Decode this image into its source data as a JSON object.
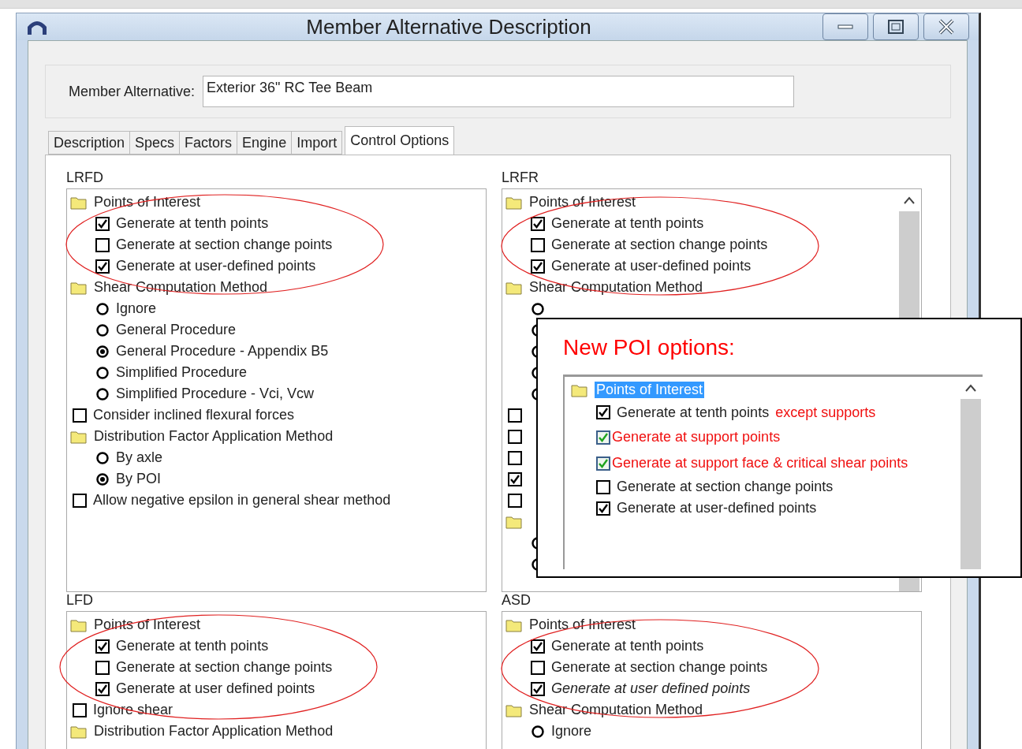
{
  "window": {
    "title": "Member Alternative Description"
  },
  "member_alternative": {
    "label": "Member Alternative:",
    "value": "Exterior 36\" RC Tee Beam"
  },
  "tabs": [
    {
      "label": "Description",
      "selected": false
    },
    {
      "label": "Specs",
      "selected": false
    },
    {
      "label": "Factors",
      "selected": false
    },
    {
      "label": "Engine",
      "selected": false
    },
    {
      "label": "Import",
      "selected": false
    },
    {
      "label": "Control Options",
      "selected": true
    }
  ],
  "panels": [
    {
      "title": "LRFD",
      "scrollable": false,
      "rows": [
        {
          "kind": "folder",
          "label": "Points of Interest",
          "children": [
            {
              "kind": "checkbox",
              "label": "Generate at tenth points",
              "checked": true
            },
            {
              "kind": "checkbox",
              "label": "Generate at section change points",
              "checked": false
            },
            {
              "kind": "checkbox",
              "label": "Generate at user-defined points",
              "checked": true
            }
          ]
        },
        {
          "kind": "folder",
          "label": "Shear Computation Method",
          "children": [
            {
              "kind": "radio",
              "label": "Ignore",
              "selected": false
            },
            {
              "kind": "radio",
              "label": "General Procedure",
              "selected": false
            },
            {
              "kind": "radio",
              "label": "General Procedure - Appendix B5",
              "selected": true
            },
            {
              "kind": "radio",
              "label": "Simplified Procedure",
              "selected": false
            },
            {
              "kind": "radio",
              "label": "Simplified Procedure - Vci, Vcw",
              "selected": false
            }
          ]
        },
        {
          "kind": "checkbox",
          "label": "Consider inclined flexural forces",
          "checked": false
        },
        {
          "kind": "folder",
          "label": "Distribution Factor Application Method",
          "children": [
            {
              "kind": "radio",
              "label": "By axle",
              "selected": false
            },
            {
              "kind": "radio",
              "label": "By POI",
              "selected": true
            }
          ]
        },
        {
          "kind": "checkbox",
          "label": "Allow negative epsilon in general shear method",
          "checked": false
        }
      ]
    },
    {
      "title": "LRFR",
      "scrollable": true,
      "rows": [
        {
          "kind": "folder",
          "label": "Points of Interest",
          "children": [
            {
              "kind": "checkbox",
              "label": "Generate at tenth points",
              "checked": true
            },
            {
              "kind": "checkbox",
              "label": "Generate at section change points",
              "checked": false
            },
            {
              "kind": "checkbox",
              "label": "Generate at user-defined points",
              "checked": true
            }
          ]
        },
        {
          "kind": "folder",
          "label": "Shear Computation Method",
          "children": [
            {
              "kind": "radio",
              "selected": false
            },
            {
              "kind": "radio",
              "selected": false
            },
            {
              "kind": "radio",
              "selected": false
            },
            {
              "kind": "radio",
              "selected": false
            },
            {
              "kind": "radio",
              "selected": false
            }
          ]
        },
        {
          "kind": "checkbox",
          "checked": false
        },
        {
          "kind": "checkbox",
          "checked": false
        },
        {
          "kind": "checkbox",
          "checked": false
        },
        {
          "kind": "checkbox",
          "checked": true
        },
        {
          "kind": "checkbox",
          "checked": false
        },
        {
          "kind": "folder",
          "children": [
            {
              "kind": "radio",
              "selected": false
            },
            {
              "kind": "radio",
              "selected": false
            }
          ]
        }
      ]
    },
    {
      "title": "LFD",
      "scrollable": false,
      "rows": [
        {
          "kind": "folder",
          "label": "Points of Interest",
          "children": [
            {
              "kind": "checkbox",
              "label": "Generate at tenth points",
              "checked": true
            },
            {
              "kind": "checkbox",
              "label": "Generate at section change points",
              "checked": false
            },
            {
              "kind": "checkbox",
              "label": "Generate at user defined points",
              "checked": true
            }
          ]
        },
        {
          "kind": "checkbox",
          "label": "Ignore shear",
          "checked": false
        },
        {
          "kind": "folder",
          "label": "Distribution Factor Application Method"
        }
      ]
    },
    {
      "title": "ASD",
      "scrollable": false,
      "rows": [
        {
          "kind": "folder",
          "label": "Points of Interest",
          "children": [
            {
              "kind": "checkbox",
              "label": "Generate at tenth points",
              "checked": true
            },
            {
              "kind": "checkbox",
              "label": "Generate at section change points",
              "checked": false
            },
            {
              "kind": "checkbox",
              "label": "Generate at user defined points",
              "checked": true,
              "italic": true
            }
          ]
        },
        {
          "kind": "folder",
          "label": "Shear Computation Method",
          "children": [
            {
              "kind": "radio",
              "label": "Ignore",
              "selected": false
            }
          ]
        }
      ]
    }
  ],
  "callout": {
    "title": "New POI options:",
    "folder": {
      "label": "Points of Interest",
      "selected": true
    },
    "rows": [
      {
        "kind": "checkbox",
        "label": "Generate at tenth points",
        "note": "except supports",
        "checked": true
      },
      {
        "kind": "new_checkbox",
        "label": "Generate at support points",
        "checked": true
      },
      {
        "kind": "new_checkbox",
        "label": "Generate at support face & critical shear points",
        "checked": true
      },
      {
        "kind": "checkbox",
        "label": "Generate at section change points",
        "checked": false
      },
      {
        "kind": "checkbox",
        "label": "Generate at user-defined points",
        "checked": true
      }
    ]
  }
}
